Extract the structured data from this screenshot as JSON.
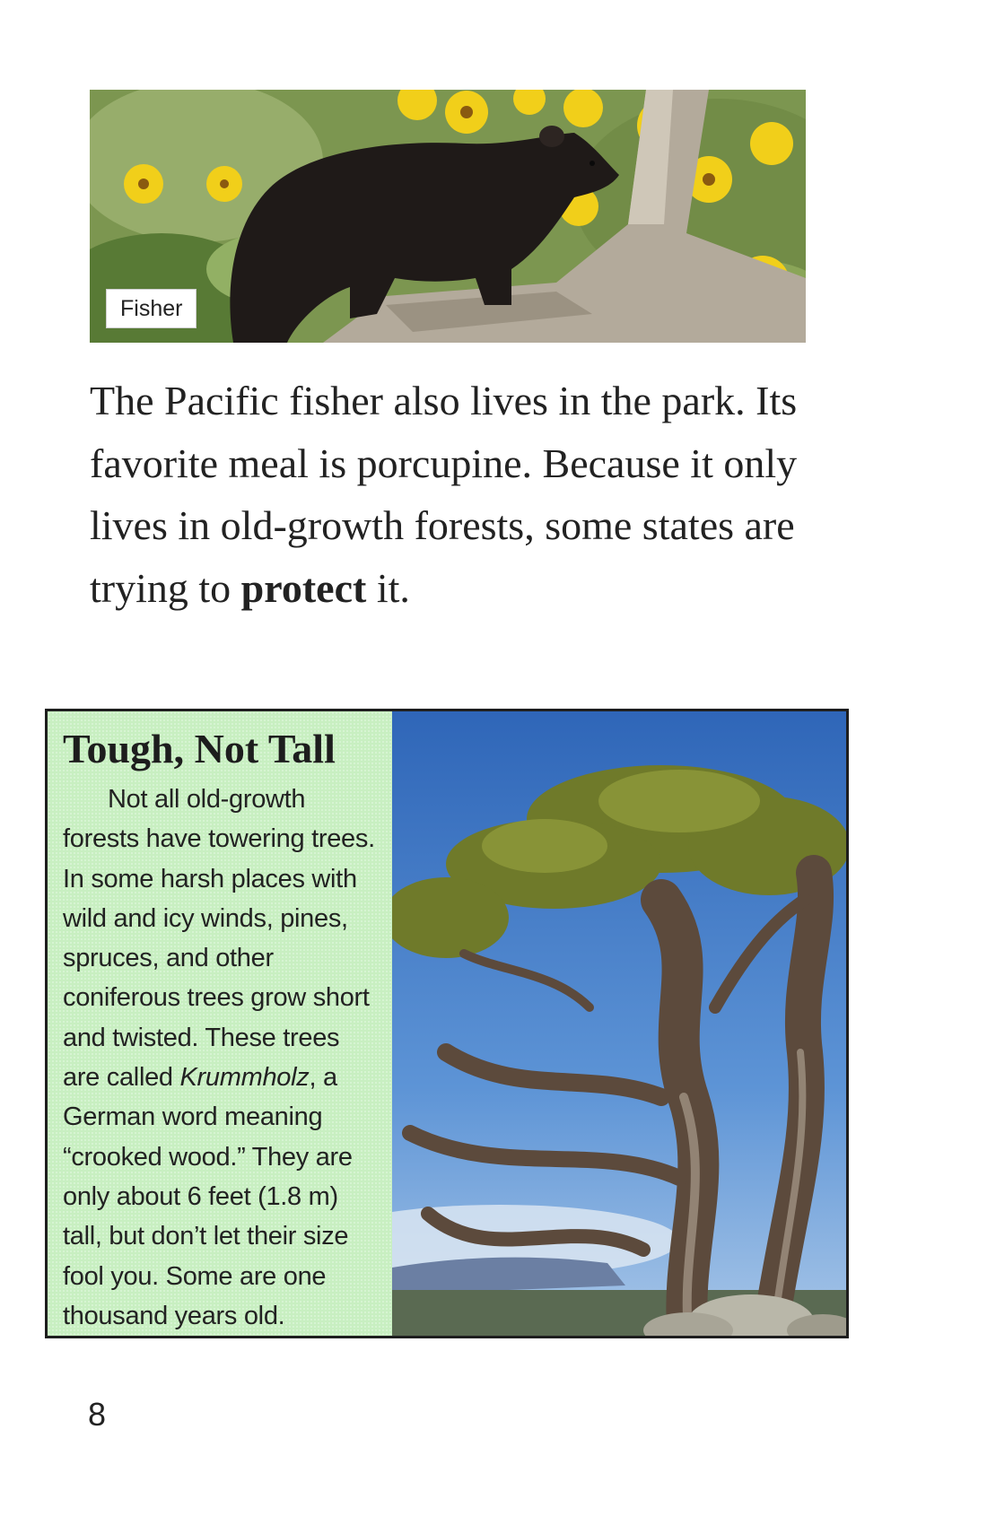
{
  "photo_top": {
    "caption": "Fisher",
    "subject_icon": "fisher-animal-photo"
  },
  "body": {
    "text_before_bold": "The Pacific fisher also lives in the park. Its favorite meal is porcupine. Because it only lives in old-growth forests, some states are trying to ",
    "bold_word": "protect",
    "text_after_bold": " it."
  },
  "sidebar": {
    "heading": "Tough, Not Tall",
    "text_part1": "Not all old-growth forests have towering trees. In some harsh places with wild and icy winds, pines, spruces, and other coniferous trees grow short and twisted. These trees are called ",
    "italic_word": "Krummholz",
    "text_part2": ", a German word meaning “crooked wood.” They are only about 6 feet (1.8 m) tall, but don’t let their size fool you. Some are one thousand years old.",
    "photo_icon": "krummholz-tree-photo",
    "panel_color": "#c8efc1"
  },
  "page": {
    "number": "8"
  }
}
